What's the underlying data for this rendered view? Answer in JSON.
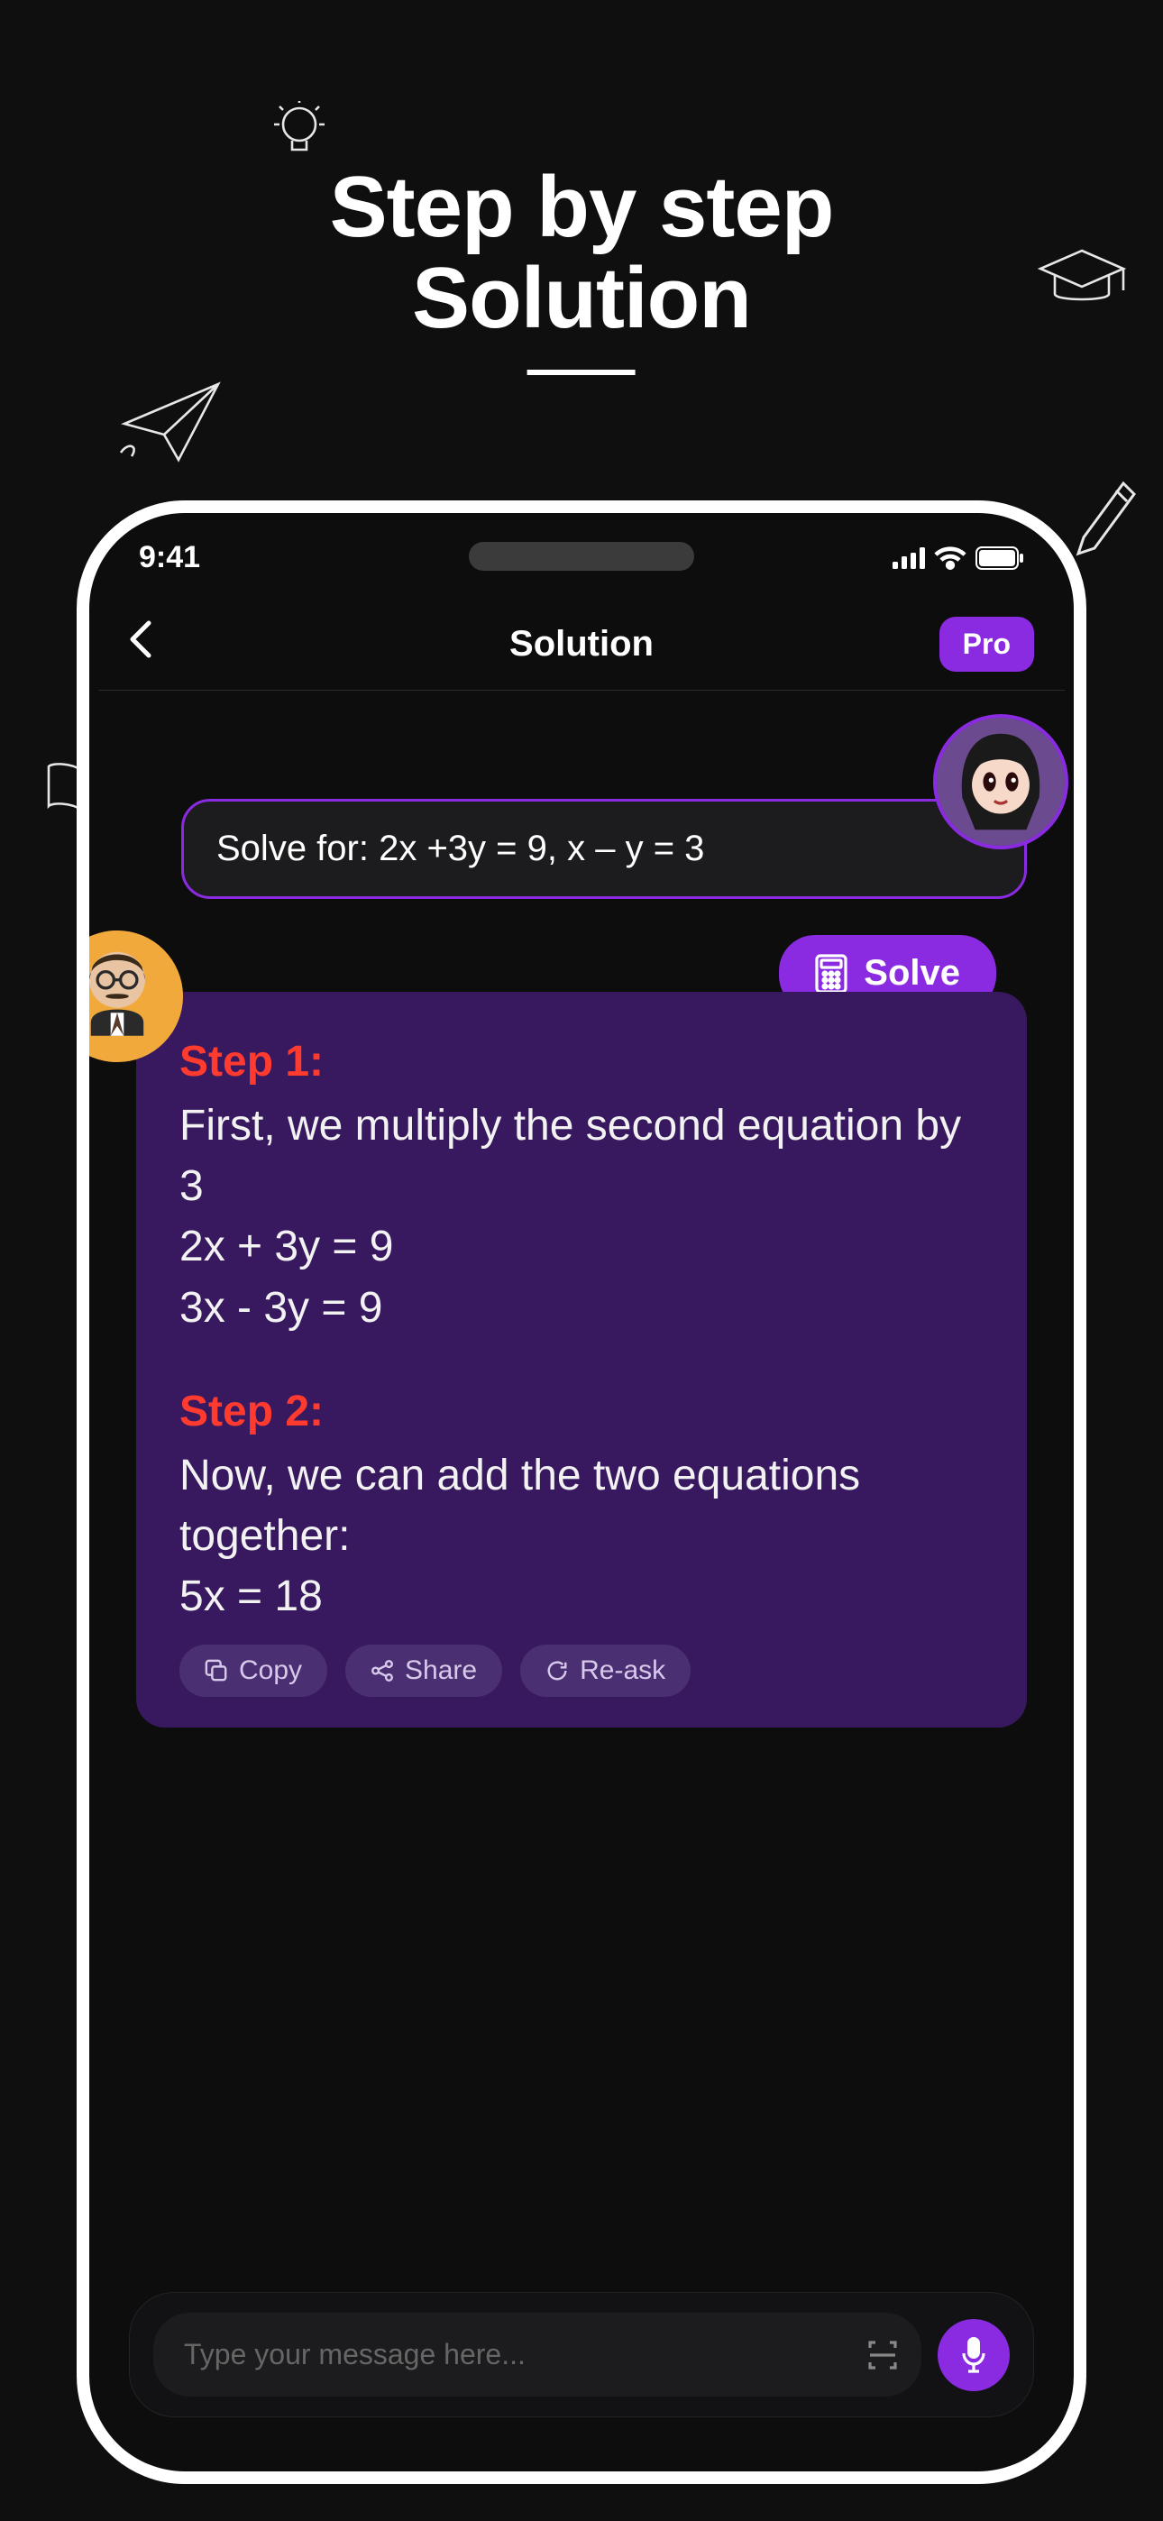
{
  "promo": {
    "title_line1": "Step by step",
    "title_line2": "Solution"
  },
  "statusbar": {
    "time": "9:41"
  },
  "nav": {
    "title": "Solution",
    "pro_label": "Pro"
  },
  "chat": {
    "user_message": "Solve for: 2x +3y = 9, x –  y = 3",
    "solve_label": "Solve",
    "steps": [
      {
        "label": "Step 1:",
        "text": "First, we multiply the second equation by 3",
        "eq1": "2x + 3y = 9",
        "eq2": "3x - 3y = 9"
      },
      {
        "label": "Step 2:",
        "text": "Now, we can add the two equations together:",
        "eq1": "5x = 18",
        "eq2": ""
      }
    ],
    "actions": {
      "copy": "Copy",
      "share": "Share",
      "reask": "Re-ask"
    }
  },
  "composer": {
    "placeholder": "Type your message here..."
  }
}
